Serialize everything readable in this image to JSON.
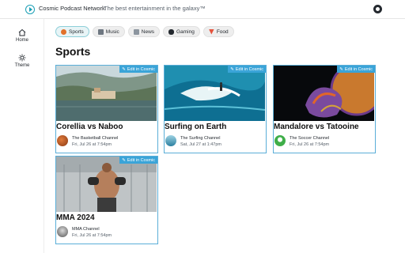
{
  "header": {
    "brand": "Cosmic Podcast Network",
    "tagline": "The best entertainment in the galaxy™"
  },
  "sidebar": {
    "items": [
      {
        "label": "Home",
        "icon": "home-icon"
      },
      {
        "label": "Theme",
        "icon": "sun-icon"
      }
    ]
  },
  "categories": [
    {
      "label": "Sports",
      "icon": "basketball-icon",
      "active": true
    },
    {
      "label": "Music",
      "icon": "music-icon",
      "active": false
    },
    {
      "label": "News",
      "icon": "newspaper-icon",
      "active": false
    },
    {
      "label": "Gaming",
      "icon": "gamepad-icon",
      "active": false
    },
    {
      "label": "Food",
      "icon": "pizza-icon",
      "active": false
    }
  ],
  "page": {
    "title": "Sports"
  },
  "cards": [
    {
      "edit": "Edit in Cosmic",
      "title": "Corellia vs Naboo",
      "channel": "The Basketball Channel",
      "date": "Fri, Jul 26 at 7:54pm"
    },
    {
      "edit": "Edit in Cosmic",
      "title": "Surfing on Earth",
      "channel": "The Surfing Channel",
      "date": "Sat, Jul 27 at 1:47pm"
    },
    {
      "edit": "Edit in Cosmic",
      "title": "Mandalore vs Tatooine",
      "channel": "The Soccer Channel",
      "date": "Fri, Jul 26 at 7:54pm"
    },
    {
      "edit": "Edit in Cosmic",
      "title": "MMA 2024",
      "channel": "MMA Channel",
      "date": "Fri, Jul 26 at 7:54pm"
    }
  ],
  "colors": {
    "accent": "#3aa4d8",
    "brand": "#1a9fb5"
  }
}
